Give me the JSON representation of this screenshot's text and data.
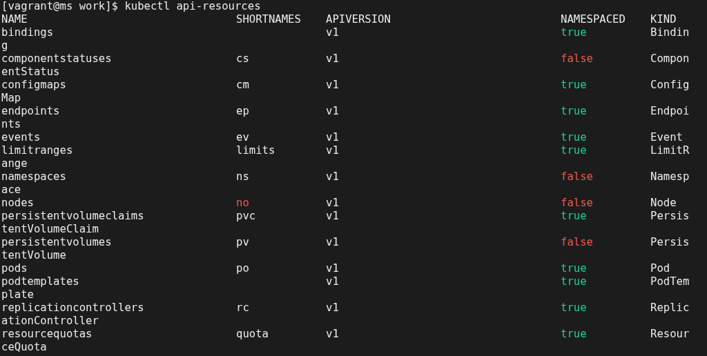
{
  "prompt": "[vagrant@ms work]$ kubectl api-resources",
  "columns": [
    "NAME",
    "SHORTNAMES",
    "APIVERSION",
    "NAMESPACED",
    "KIND"
  ],
  "rows": [
    {
      "name": "bindings",
      "apiversion": "v1",
      "namespaced": {
        "text": "true",
        "color": "#23d18b"
      },
      "kind": "Bindin",
      "kind_wrap": "g"
    },
    {
      "name": "componentstatuses",
      "shortname": {
        "text": "cs"
      },
      "apiversion": "v1",
      "namespaced": {
        "text": "false",
        "color": "#ee5a4f"
      },
      "kind": "Compon",
      "kind_wrap": "entStatus"
    },
    {
      "name": "configmaps",
      "shortname": {
        "text": "cm"
      },
      "apiversion": "v1",
      "namespaced": {
        "text": "true",
        "color": "#23d18b"
      },
      "kind": "Config",
      "kind_wrap": "Map"
    },
    {
      "name": "endpoints",
      "shortname": {
        "text": "ep"
      },
      "apiversion": "v1",
      "namespaced": {
        "text": "true",
        "color": "#23d18b"
      },
      "kind": "Endpoi",
      "kind_wrap": "nts"
    },
    {
      "name": "events",
      "shortname": {
        "text": "ev"
      },
      "apiversion": "v1",
      "namespaced": {
        "text": "true",
        "color": "#23d18b"
      },
      "kind": "Event"
    },
    {
      "name": "limitranges",
      "shortname": {
        "text": "limits"
      },
      "apiversion": "v1",
      "namespaced": {
        "text": "true",
        "color": "#23d18b"
      },
      "kind": "LimitR",
      "kind_wrap": "ange"
    },
    {
      "name": "namespaces",
      "shortname": {
        "text": "ns"
      },
      "apiversion": "v1",
      "namespaced": {
        "text": "false",
        "color": "#ee5a4f"
      },
      "kind": "Namesp",
      "kind_wrap": "ace"
    },
    {
      "name": "nodes",
      "shortname": {
        "text": "no",
        "color": "#ee5a4f"
      },
      "apiversion": "v1",
      "namespaced": {
        "text": "false",
        "color": "#ee5a4f"
      },
      "kind": "Node"
    },
    {
      "name": "persistentvolumeclaims",
      "shortname": {
        "text": "pvc"
      },
      "apiversion": "v1",
      "namespaced": {
        "text": "true",
        "color": "#23d18b"
      },
      "kind": "Persis",
      "kind_wrap": "tentVolumeClaim"
    },
    {
      "name": "persistentvolumes",
      "shortname": {
        "text": "pv"
      },
      "apiversion": "v1",
      "namespaced": {
        "text": "false",
        "color": "#ee5a4f"
      },
      "kind": "Persis",
      "kind_wrap": "tentVolume"
    },
    {
      "name": "pods",
      "shortname": {
        "text": "po"
      },
      "apiversion": "v1",
      "namespaced": {
        "text": "true",
        "color": "#23d18b"
      },
      "kind": "Pod"
    },
    {
      "name": "podtemplates",
      "apiversion": "v1",
      "namespaced": {
        "text": "true",
        "color": "#23d18b"
      },
      "kind": "PodTem",
      "kind_wrap": "plate"
    },
    {
      "name": "replicationcontrollers",
      "shortname": {
        "text": "rc"
      },
      "apiversion": "v1",
      "namespaced": {
        "text": "true",
        "color": "#23d18b"
      },
      "kind": "Replic",
      "kind_wrap": "ationController"
    },
    {
      "name": "resourcequotas",
      "shortname": {
        "text": "quota"
      },
      "apiversion": "v1",
      "namespaced": {
        "text": "true",
        "color": "#23d18b"
      },
      "kind": "Resour",
      "kind_wrap": "ceQuota"
    }
  ]
}
